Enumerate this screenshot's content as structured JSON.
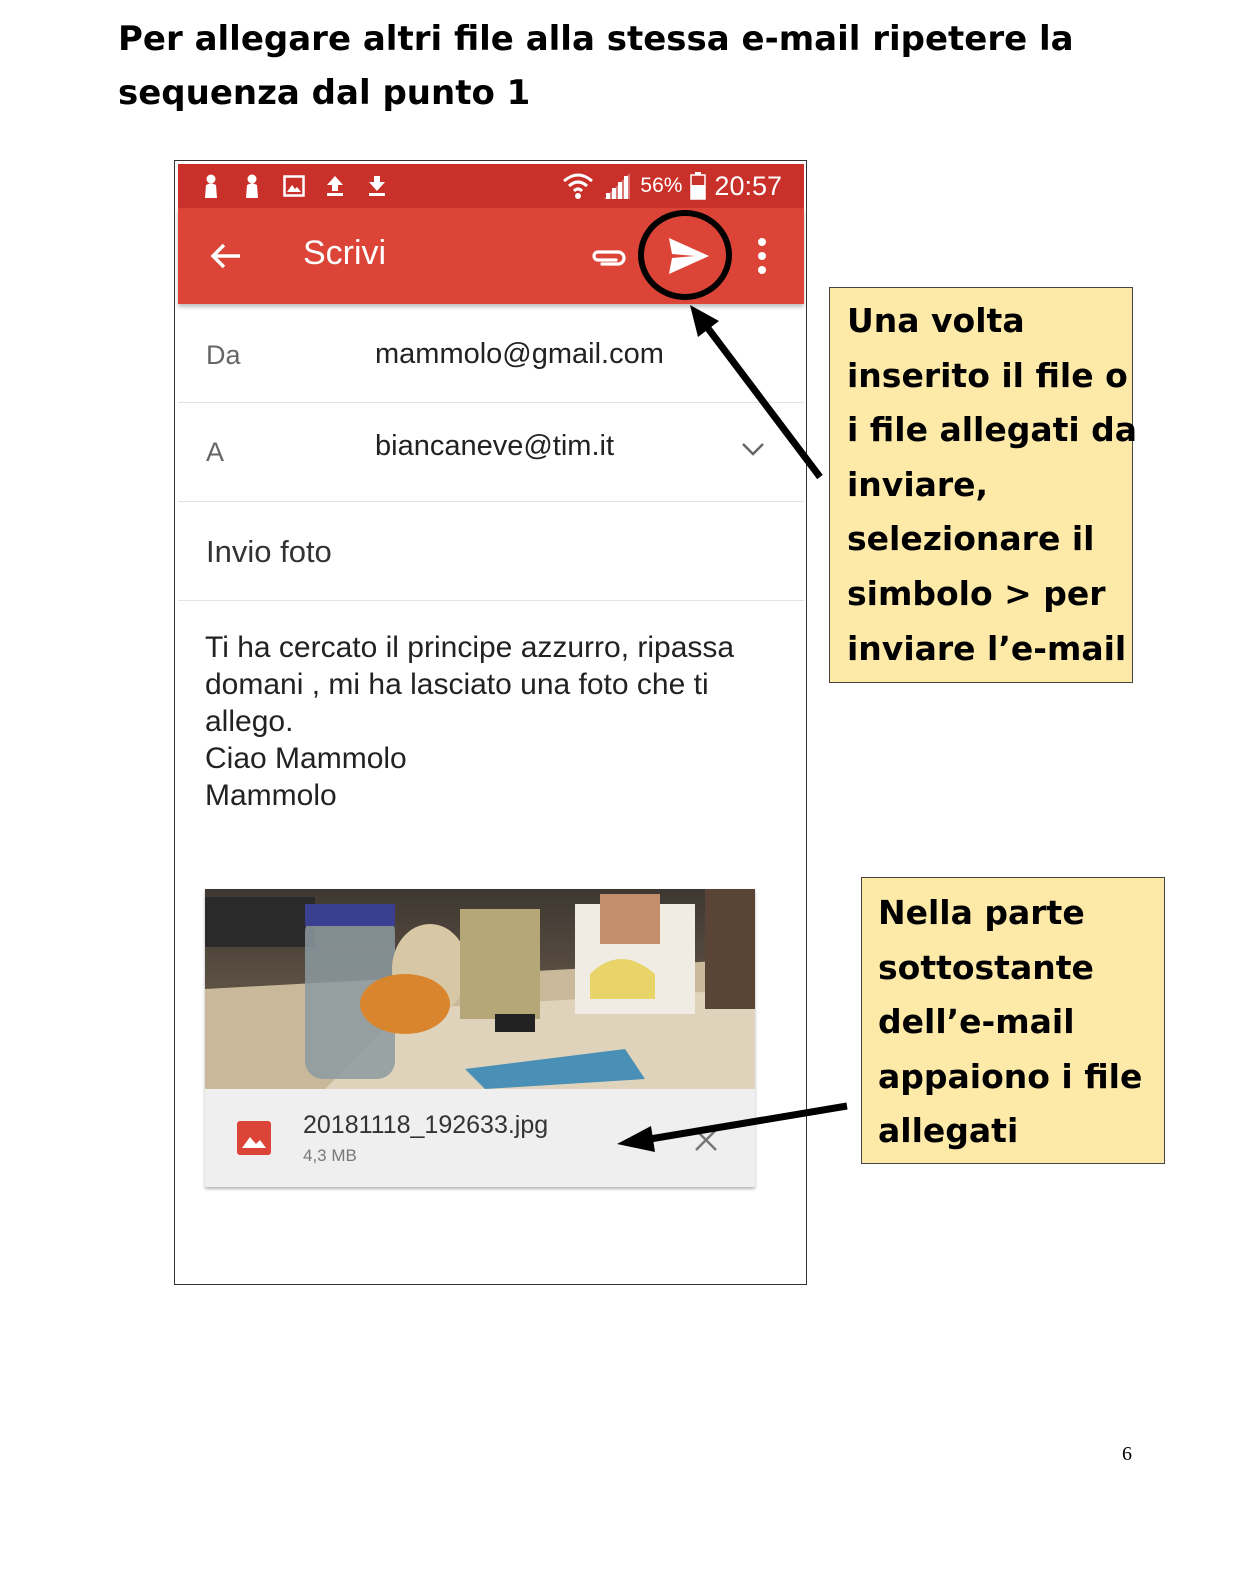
{
  "heading": {
    "line1": "Per allegare altri file alla stessa e-mail ripetere la",
    "line2": "sequenza dal punto 1"
  },
  "phone": {
    "status_bar": {
      "icons": [
        "person-icon",
        "person-icon",
        "image-icon",
        "upload-icon",
        "download-icon",
        "wifi-icon",
        "signal-icon",
        "battery-icon"
      ],
      "battery": "56%",
      "time": "20:57"
    },
    "toolbar": {
      "title": "Scrivi",
      "color": "#dc4437"
    },
    "from": {
      "label": "Da",
      "value": "mammolo@gmail.com"
    },
    "to": {
      "label": "A",
      "value": "biancaneve@tim.it"
    },
    "subject": "Invio foto",
    "body": [
      "Ti ha cercato il principe azzurro, ripassa",
      "domani , mi ha lasciato una foto che ti",
      "allego.",
      "Ciao Mammolo",
      "Mammolo"
    ],
    "attachment": {
      "file_name": "20181118_192633.jpg",
      "file_size": "4,3 MB"
    }
  },
  "callouts": {
    "send": [
      "Una volta",
      "inserito il file o",
      "i file allegati da",
      "inviare,",
      "selezionare il",
      "simbolo > per",
      "inviare l’e-mail"
    ],
    "attachments": [
      "Nella parte",
      "sottostante",
      "dell’e-mail",
      "appaiono i file",
      "allegati"
    ],
    "background": "#fde9a8"
  },
  "page_number": "6"
}
